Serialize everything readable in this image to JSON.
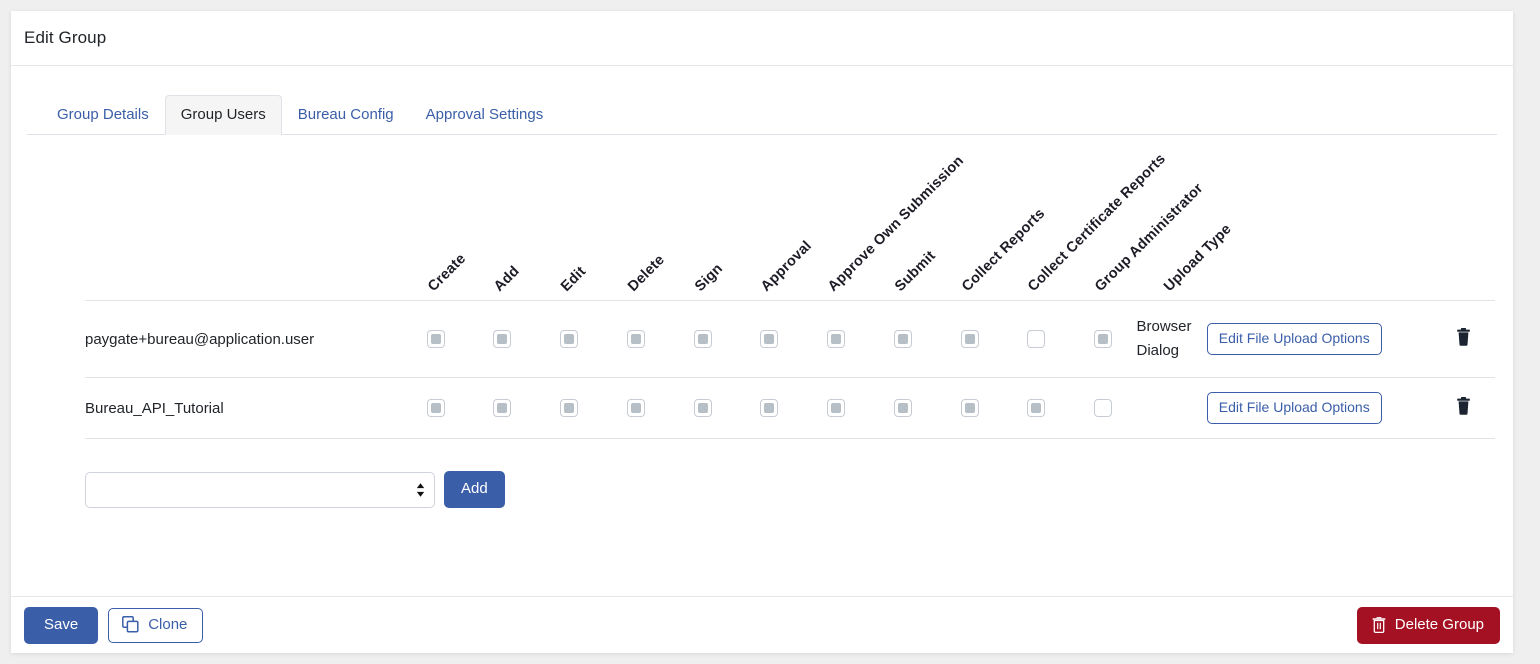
{
  "window": {
    "title": "Edit Group"
  },
  "tabs": [
    {
      "label": "Group Details",
      "active": false
    },
    {
      "label": "Group Users",
      "active": true
    },
    {
      "label": "Bureau Config",
      "active": false
    },
    {
      "label": "Approval Settings",
      "active": false
    }
  ],
  "table": {
    "user_column_header": "",
    "permission_columns": [
      "Create",
      "Add",
      "Edit",
      "Delete",
      "Sign",
      "Approval",
      "Approve Own Submission",
      "Submit",
      "Collect Reports",
      "Collect Certificate Reports",
      "Group Administrator"
    ],
    "upload_type_header": "Upload Type",
    "rows": [
      {
        "user": "paygate+bureau@application.user",
        "permissions": [
          true,
          true,
          true,
          true,
          true,
          true,
          true,
          true,
          true,
          false,
          true
        ],
        "upload_type": "Browser Dialog",
        "edit_button_label": "Edit File Upload Options",
        "delete_icon": "trash-icon"
      },
      {
        "user": "Bureau_API_Tutorial",
        "permissions": [
          true,
          true,
          true,
          true,
          true,
          true,
          true,
          true,
          true,
          true,
          false
        ],
        "upload_type": "",
        "edit_button_label": "Edit File Upload Options",
        "delete_icon": "trash-icon"
      }
    ]
  },
  "add_user": {
    "select_value": "",
    "add_button_label": "Add"
  },
  "footer": {
    "save_label": "Save",
    "clone_label": "Clone",
    "clone_icon": "copy-icon",
    "delete_group_label": "Delete Group",
    "delete_group_icon": "trash-icon"
  },
  "colors": {
    "primary": "#3b5ea8",
    "danger": "#a41122",
    "page_bg": "#efefef",
    "card_bg": "#ffffff",
    "border": "#e3e3e3"
  }
}
